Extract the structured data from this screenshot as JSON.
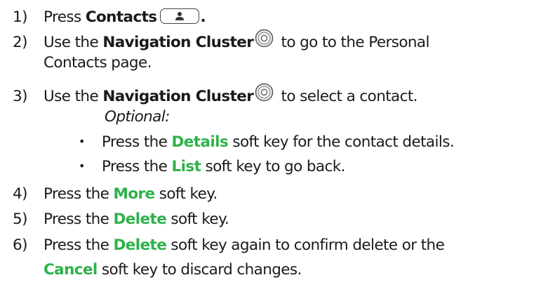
{
  "steps": [
    {
      "num": "1)",
      "lines": [
        {
          "parts": [
            {
              "t": "Press ",
              "s": "plain"
            },
            {
              "t": "Contacts",
              "s": "bold"
            },
            {
              "t": "contacts-key",
              "s": "icon"
            },
            {
              "t": ".",
              "s": "bold"
            }
          ]
        }
      ]
    },
    {
      "num": "2)",
      "lines": [
        {
          "parts": [
            {
              "t": "Use the ",
              "s": "plain"
            },
            {
              "t": "Navigation Cluster",
              "s": "bold"
            },
            {
              "t": "navigation-cluster",
              "s": "icon"
            },
            {
              "t": " to go to the Personal",
              "s": "plain"
            }
          ]
        },
        {
          "parts": [
            {
              "t": "Contacts page.",
              "s": "plain"
            }
          ]
        }
      ]
    },
    {
      "num": "3)",
      "lines": [
        {
          "parts": [
            {
              "t": "Use the ",
              "s": "plain"
            },
            {
              "t": "Navigation Cluster",
              "s": "bold"
            },
            {
              "t": "navigation-cluster",
              "s": "icon"
            },
            {
              "t": " to select a contact.",
              "s": "plain"
            }
          ]
        }
      ]
    },
    {
      "optional_label": "Optional:",
      "bullets": [
        {
          "parts": [
            {
              "t": "Press the ",
              "s": "plain"
            },
            {
              "t": "Details",
              "s": "green"
            },
            {
              "t": " soft key for the contact details.",
              "s": "plain"
            }
          ]
        },
        {
          "parts": [
            {
              "t": "Press the ",
              "s": "plain"
            },
            {
              "t": "List",
              "s": "green"
            },
            {
              "t": " soft key to go back.",
              "s": "plain"
            }
          ]
        }
      ]
    },
    {
      "num": "4)",
      "lines": [
        {
          "parts": [
            {
              "t": "Press the ",
              "s": "plain"
            },
            {
              "t": "More",
              "s": "green"
            },
            {
              "t": " soft key.",
              "s": "plain"
            }
          ]
        }
      ]
    },
    {
      "num": "5)",
      "lines": [
        {
          "parts": [
            {
              "t": "Press the ",
              "s": "plain"
            },
            {
              "t": "Delete",
              "s": "green"
            },
            {
              "t": " soft key.",
              "s": "plain"
            }
          ]
        }
      ]
    },
    {
      "num": "6)",
      "lines": [
        {
          "parts": [
            {
              "t": "Press the ",
              "s": "plain"
            },
            {
              "t": "Delete",
              "s": "green"
            },
            {
              "t": " soft key again to confirm delete or the",
              "s": "plain"
            }
          ]
        },
        {
          "parts": [
            {
              "t": "Cancel",
              "s": "green"
            },
            {
              "t": " soft key to discard changes.",
              "s": "plain"
            }
          ]
        }
      ]
    }
  ],
  "colors": {
    "keyword_green": "#2eb24a",
    "text": "#1a1a1a"
  },
  "icons": {
    "contacts-key": "person-key-icon",
    "navigation-cluster": "navigation-cluster-icon"
  }
}
